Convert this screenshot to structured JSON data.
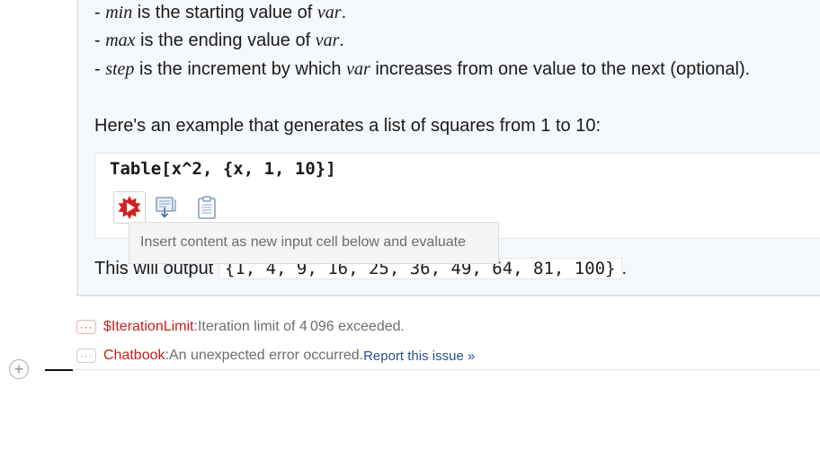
{
  "explanation": {
    "min_term": "min",
    "min_text": " is the starting value of ",
    "max_term": "max",
    "max_text": " is the ending value of ",
    "step_term": "step",
    "step_text_1": " is the increment by which ",
    "step_text_2": " increases from one value to the next (optional).",
    "var_word": "var",
    "dash": "- ",
    "period": "."
  },
  "example_intro": "Here's an example that generates a list of squares from 1 to 10:",
  "code": "Table[x^2, {x, 1, 10}]",
  "code_toolbar": {
    "evaluate_icon": "evaluate-icon",
    "insert_icon": "insert-cell-icon",
    "copy_icon": "clipboard-icon"
  },
  "tooltip": "Insert content as new input cell below and evaluate",
  "output_intro": "This will output ",
  "output_value": "{1, 4, 9, 16, 25, 36, 49, 64, 81, 100}",
  "output_period": ".",
  "messages": [
    {
      "dots": "···",
      "tag": "$IterationLimit",
      "separator": ": ",
      "text": "Iteration limit of 4 096 exceeded."
    },
    {
      "dots": "···",
      "tag": "Chatbook",
      "separator": " : ",
      "text": "An unexpected error occurred. ",
      "link": "Report this issue »"
    }
  ],
  "colors": {
    "error_red": "#c4221c",
    "link_blue": "#2b4f8e",
    "evaluate_red": "#d51f1f"
  }
}
